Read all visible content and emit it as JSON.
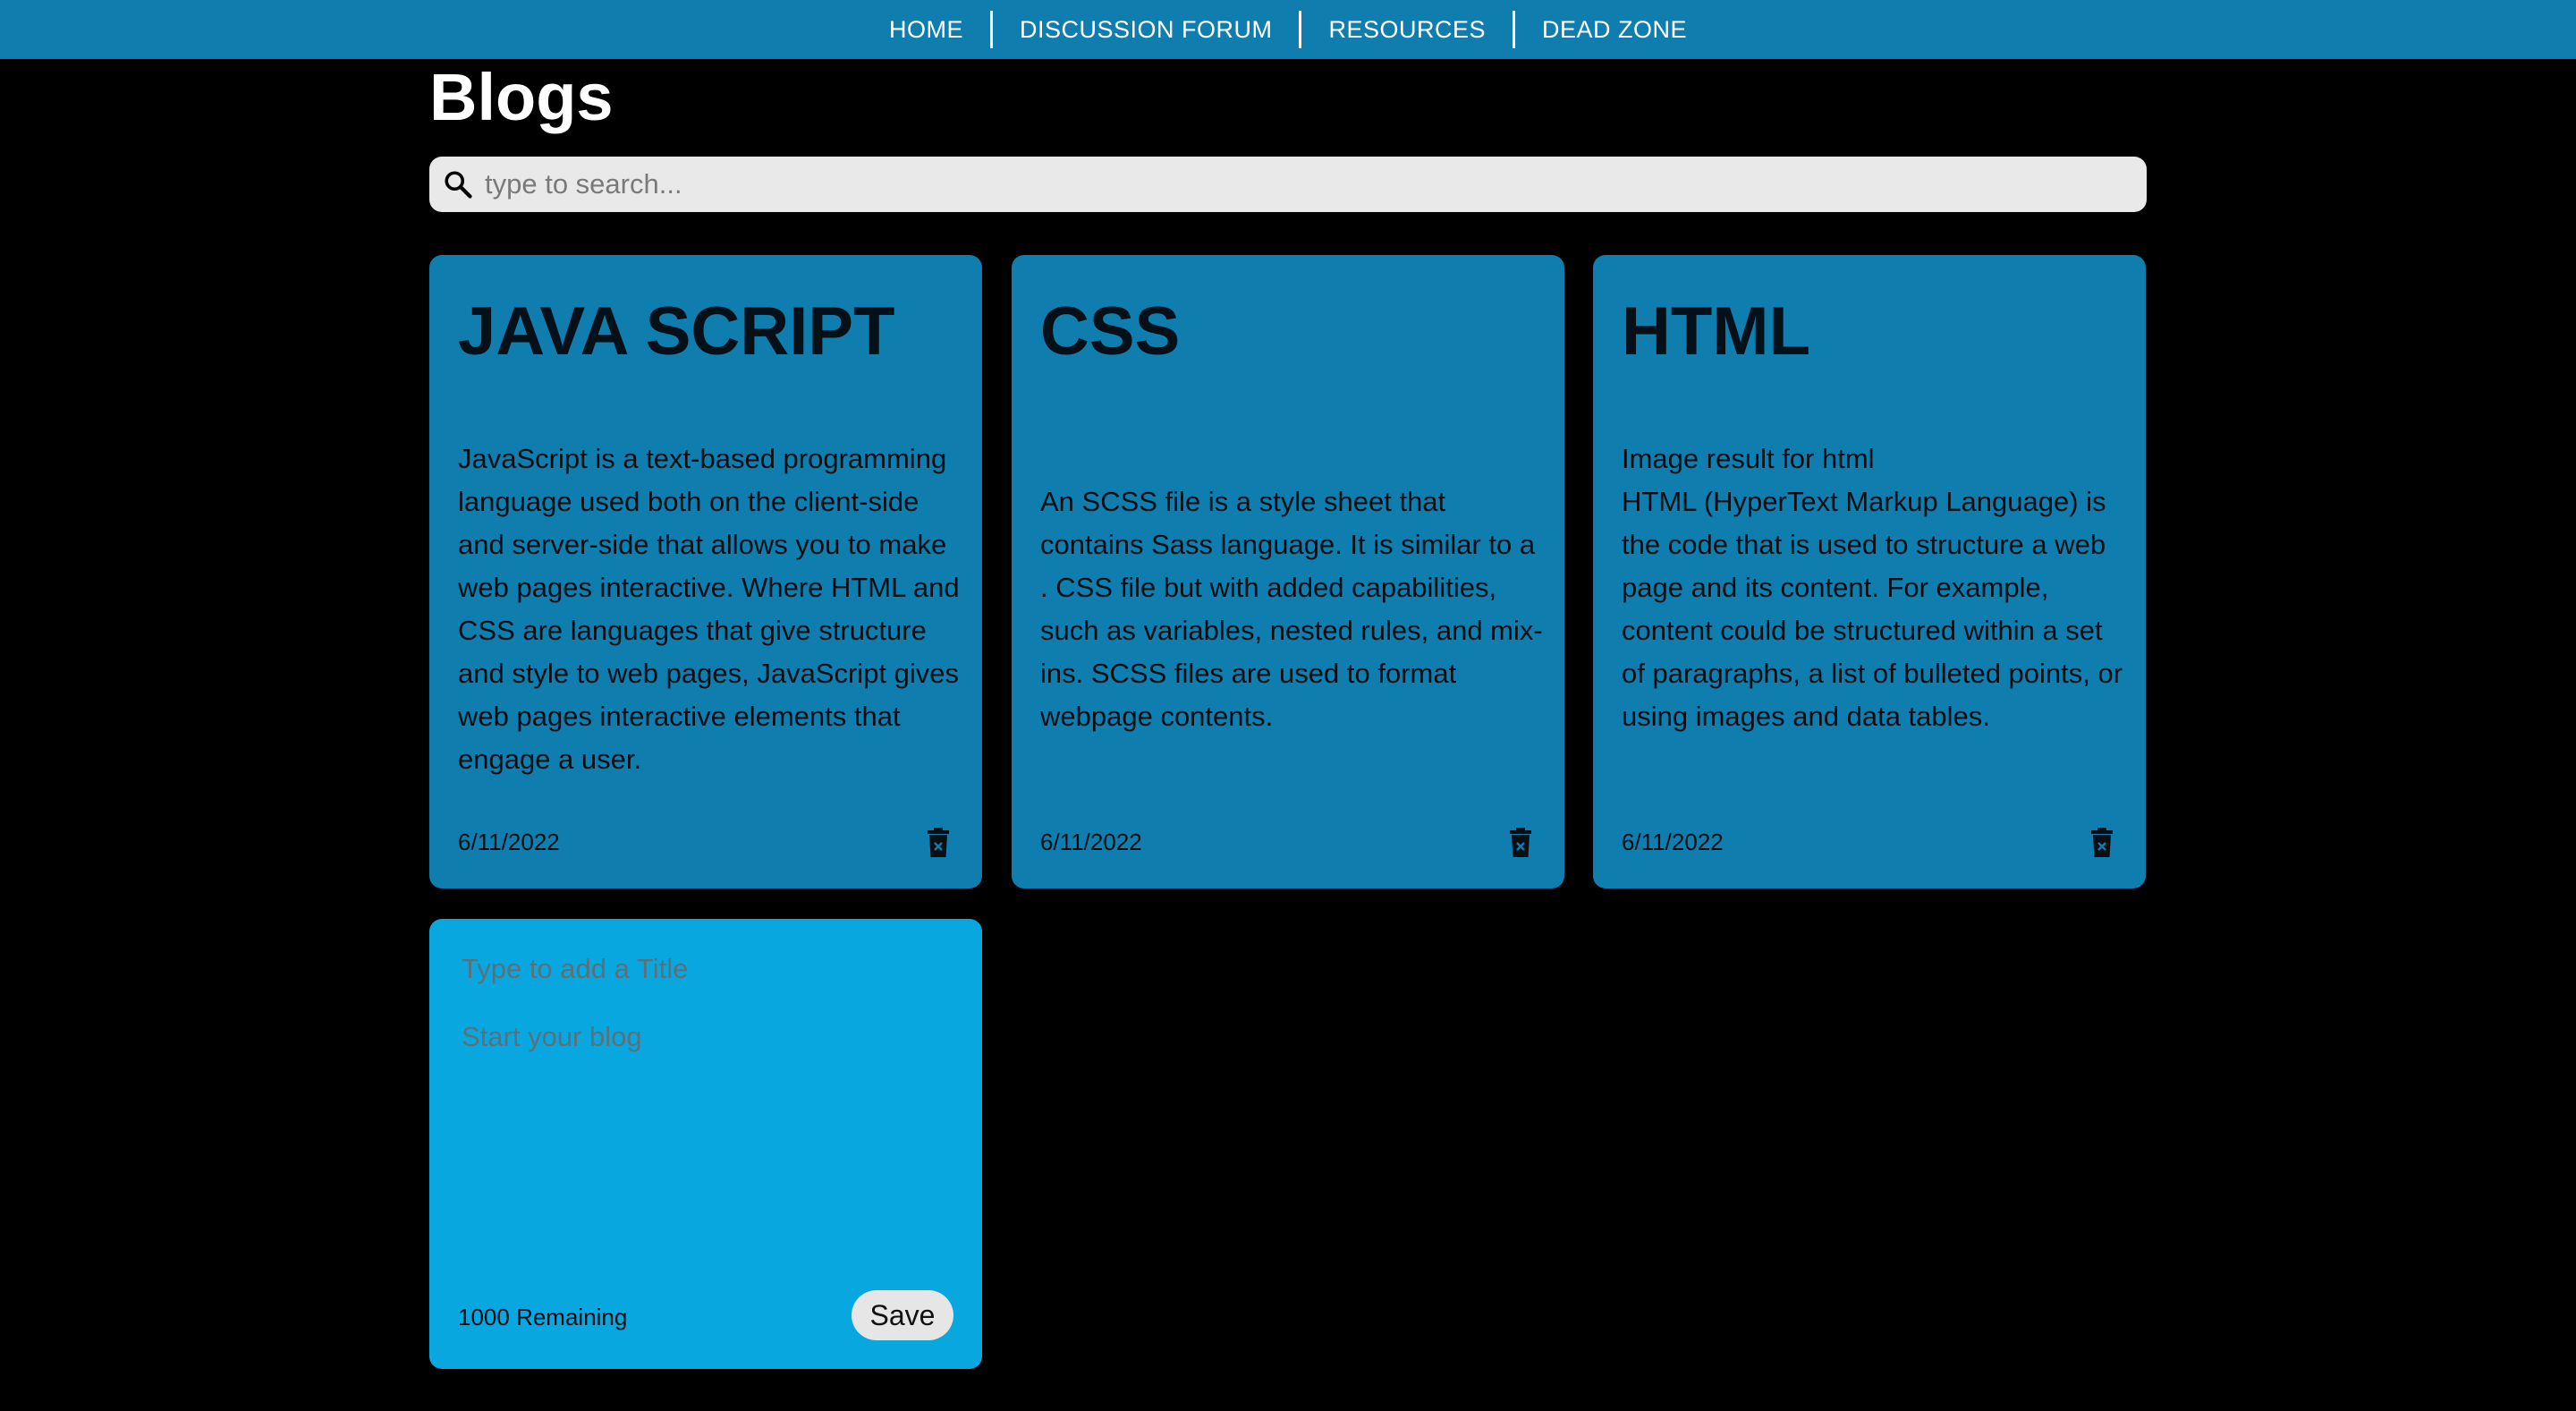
{
  "nav": {
    "items": [
      {
        "label": "HOME"
      },
      {
        "label": "DISCUSSION FORUM"
      },
      {
        "label": "RESOURCES"
      },
      {
        "label": "DEAD ZONE"
      }
    ]
  },
  "page": {
    "title": "Blogs"
  },
  "search": {
    "placeholder": "type to search...",
    "value": ""
  },
  "icons": {
    "search": "search-icon",
    "delete": "trash-icon"
  },
  "colors": {
    "nav_bg": "#0f7dad",
    "card_bg": "#0f7dad",
    "new_card_bg": "#09a7e0",
    "page_bg": "#000000"
  },
  "blogs": [
    {
      "title": "JAVA SCRIPT",
      "body": "JavaScript is a text-based programming language used both on the client-side and server-side that allows you to make web pages interactive. Where HTML and CSS are languages that give structure and style to web pages, JavaScript gives web pages interactive elements that engage a user.",
      "date": "6/11/2022"
    },
    {
      "title": "CSS",
      "body": "An SCSS file is a style sheet that contains Sass language. It is similar to a . CSS file but with added capabilities, such as variables, nested rules, and mix-ins. SCSS files are used to format webpage contents.",
      "date": "6/11/2022"
    },
    {
      "title": "HTML",
      "body": "Image result for html\nHTML (HyperText Markup Language) is the code that is used to structure a web page and its content. For example, content could be structured within a set of paragraphs, a list of bulleted points, or using images and data tables.",
      "date": "6/11/2022"
    }
  ],
  "new_blog": {
    "title_placeholder": "Type to add a Title",
    "body_placeholder": "Start your blog",
    "remaining": "1000 Remaining",
    "save_label": "Save"
  }
}
